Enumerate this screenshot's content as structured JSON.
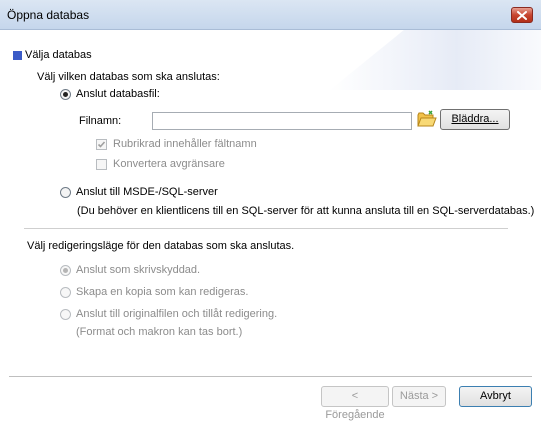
{
  "window": {
    "title": "Öppna databas"
  },
  "section1": {
    "heading": "Välja databas",
    "prompt": "Välj vilken databas som ska anslutas:",
    "option_file": {
      "label": "Anslut databasfil:",
      "selected": true
    },
    "filename_label": "Filnamn:",
    "filename_value": "",
    "browse_label": "Bläddra...",
    "check_header": {
      "label": "Rubrikrad innehåller fältnamn",
      "checked": true,
      "enabled": false
    },
    "check_convert": {
      "label": "Konvertera avgränsare",
      "checked": false,
      "enabled": false
    },
    "option_server": {
      "label": "Anslut till MSDE-/SQL-server",
      "selected": false
    },
    "server_note": "(Du behöver en klientlicens till en SQL-server för att kunna ansluta till en SQL-serverdatabas.)"
  },
  "section2": {
    "prompt": "Välj redigeringsläge för den databas som ska anslutas.",
    "options": [
      {
        "label": "Anslut som skrivskyddad.",
        "selected": true
      },
      {
        "label": "Skapa en kopia som kan redigeras.",
        "selected": false
      },
      {
        "label": "Anslut till originalfilen och tillåt redigering.",
        "selected": false
      }
    ],
    "note": "(Format och makron kan tas bort.)"
  },
  "footer": {
    "back_label": "< Föregående",
    "next_label": "Nästa >",
    "cancel_label": "Avbryt"
  },
  "colors": {
    "accent": "#3b5bc7",
    "disabled_text": "#8c8c8c"
  }
}
